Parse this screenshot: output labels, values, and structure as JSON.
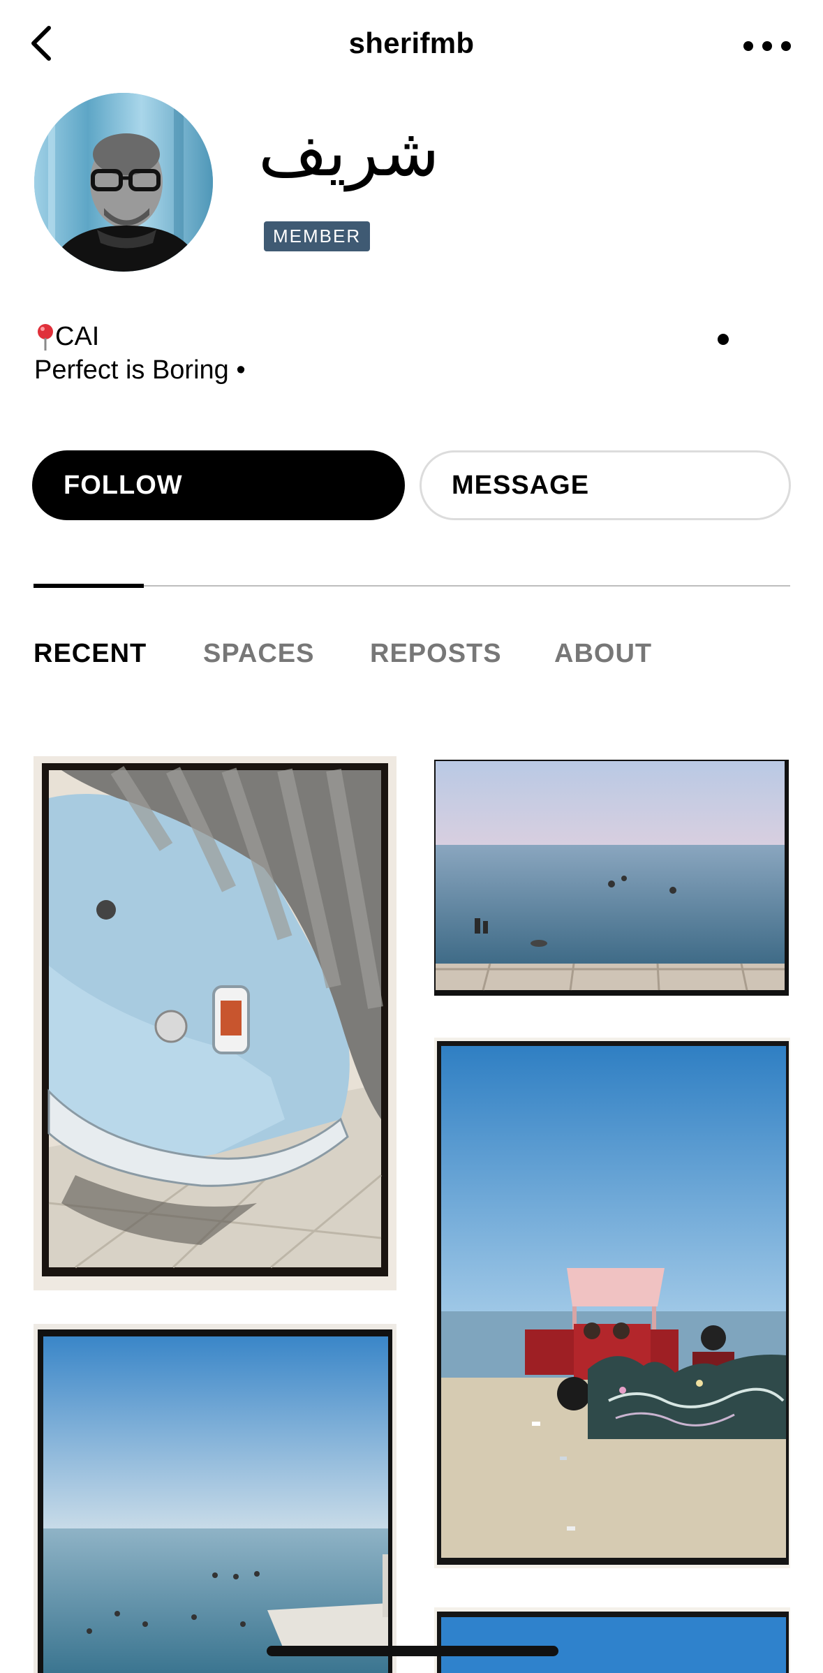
{
  "header": {
    "username": "sherifmb",
    "back_icon": "chevron-left-icon",
    "more_icon": "more-horizontal-icon"
  },
  "profile": {
    "display_name": "شريف",
    "badge": "MEMBER",
    "badge_color": "#3f5a73",
    "avatar_icon": "profile-avatar"
  },
  "bio": {
    "location": "CAI",
    "location_icon": "map-pin-icon",
    "tagline": "Perfect is Boring •"
  },
  "actions": {
    "follow_label": "FOLLOW",
    "message_label": "MESSAGE"
  },
  "tabs": [
    {
      "label": "RECENT",
      "active": true
    },
    {
      "label": "SPACES",
      "active": false
    },
    {
      "label": "REPOSTS",
      "active": false
    },
    {
      "label": "ABOUT",
      "active": false
    }
  ],
  "posts": [
    {
      "subject": "vintage light blue car under cover"
    },
    {
      "subject": "people swimming in sea"
    },
    {
      "subject": "red tuk-tuk by the sea"
    },
    {
      "subject": "sea with swimmers and pier"
    },
    {
      "subject": "blue sky"
    }
  ]
}
